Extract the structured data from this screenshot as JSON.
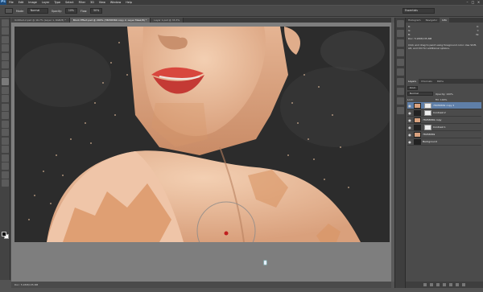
{
  "app": {
    "logo": "Ps"
  },
  "menu": [
    "File",
    "Edit",
    "Image",
    "Layer",
    "Type",
    "Select",
    "Filter",
    "3D",
    "View",
    "Window",
    "Help"
  ],
  "options": {
    "mode_label": "Mode:",
    "mode_value": "Normal",
    "opacity_label": "Opacity:",
    "opacity_value": "10%",
    "flow_label": "Flow:",
    "flow_value": "50%"
  },
  "workspace": {
    "value": "Essentials"
  },
  "tabs": [
    {
      "label": "Untitled-2.psd @ 16.7% (Layer 1, RGB/8) *"
    },
    {
      "label": "Block Effect.psd @ 200% (78058369 copy 2, Layer Mask/8) *"
    },
    {
      "label": "Layer 1.psd @ 33.3%"
    }
  ],
  "status": {
    "text": "Doc: 5.93M/135.8M"
  },
  "panels": {
    "top_tabs": [
      "Histogram",
      "Navigator",
      "Info"
    ],
    "info": {
      "rows": [
        [
          "R:",
          "X:"
        ],
        [
          "G:",
          "Y:"
        ],
        [
          "B:",
          "W:"
        ]
      ],
      "doc": "Doc: 5.93M/135.8M",
      "hint": "Click and drag to paint using foreground color. Use Shift, Alt, and Ctrl for additional options."
    },
    "layer_tabs": [
      "Layers",
      "Channels",
      "Paths"
    ],
    "layer_kind": "Kind",
    "layer_blend": "Normal",
    "layer_opacity": "Opacity: 100%",
    "layer_lock": "Lock:",
    "layer_fill": "Fill: 100%",
    "layers": [
      {
        "name": "78058369 copy 2",
        "thumb": "skin",
        "mask": true,
        "selected": true
      },
      {
        "name": "Contrast 2",
        "thumb": "dark",
        "mask": true,
        "selected": false
      },
      {
        "name": "78058369 copy",
        "thumb": "skin",
        "mask": false,
        "selected": false
      },
      {
        "name": "Contrast 1",
        "thumb": "dark",
        "mask": true,
        "selected": false
      },
      {
        "name": "78058369",
        "thumb": "skin",
        "mask": false,
        "selected": false
      },
      {
        "name": "Background",
        "thumb": "dark",
        "mask": false,
        "selected": false
      }
    ]
  },
  "colors": {
    "accent": "#5f7fa8",
    "brush_dot": "#c02020",
    "lips": "#d8473e",
    "skin": "#e9b897"
  }
}
